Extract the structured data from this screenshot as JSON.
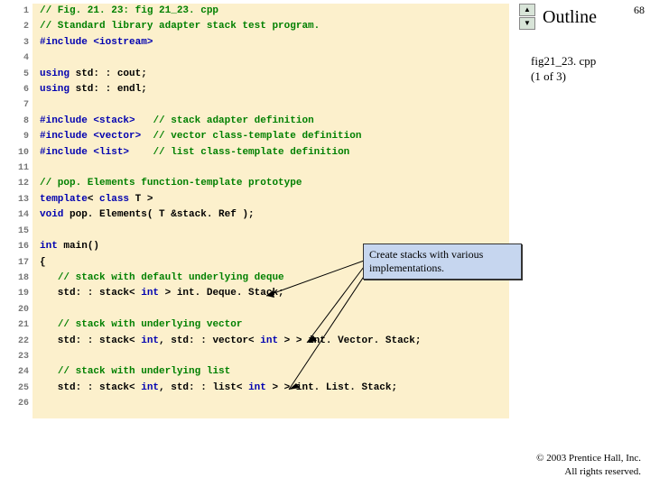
{
  "slide_number": "68",
  "outline": {
    "title": "Outline",
    "file": "fig21_23. cpp",
    "part": "(1 of 3)"
  },
  "callout": "Create stacks with various implementations.",
  "copyright": {
    "line1": "© 2003 Prentice Hall, Inc.",
    "line2": "All rights reserved."
  },
  "code": {
    "line_count": 26,
    "lines": [
      {
        "n": 1,
        "cm": "// Fig. 21. 23: fig 21_23. cpp"
      },
      {
        "n": 2,
        "cm": "// Standard library adapter stack test program."
      },
      {
        "n": 3,
        "pp": "#include <iostream>"
      },
      {
        "n": 4,
        "blank": true
      },
      {
        "n": 5,
        "raw": [
          {
            "t": "using ",
            "c": "kw"
          },
          {
            "t": "std: : cout;"
          }
        ]
      },
      {
        "n": 6,
        "raw": [
          {
            "t": "using ",
            "c": "kw"
          },
          {
            "t": "std: : endl;"
          }
        ]
      },
      {
        "n": 7,
        "blank": true
      },
      {
        "n": 8,
        "raw": [
          {
            "t": "#include <stack>",
            "c": "pp"
          },
          {
            "t": "   "
          },
          {
            "t": "// stack adapter definition",
            "c": "cm"
          }
        ]
      },
      {
        "n": 9,
        "raw": [
          {
            "t": "#include <vector>",
            "c": "pp"
          },
          {
            "t": "  "
          },
          {
            "t": "// vector class-template definition",
            "c": "cm"
          }
        ]
      },
      {
        "n": 10,
        "raw": [
          {
            "t": "#include <list>",
            "c": "pp"
          },
          {
            "t": "    "
          },
          {
            "t": "// list class-template definition",
            "c": "cm"
          }
        ]
      },
      {
        "n": 11,
        "blank": true
      },
      {
        "n": 12,
        "cm": "// pop. Elements function-template prototype"
      },
      {
        "n": 13,
        "raw": [
          {
            "t": "template",
            "c": "kw"
          },
          {
            "t": "< "
          },
          {
            "t": "class",
            "c": "kw"
          },
          {
            "t": " T >"
          }
        ]
      },
      {
        "n": 14,
        "raw": [
          {
            "t": "void",
            "c": "kw"
          },
          {
            "t": " pop. Elements( T &stack. Ref );"
          }
        ]
      },
      {
        "n": 15,
        "blank": true
      },
      {
        "n": 16,
        "raw": [
          {
            "t": "int",
            "c": "kw"
          },
          {
            "t": " main()"
          }
        ]
      },
      {
        "n": 17,
        "raw": [
          {
            "t": "{"
          }
        ]
      },
      {
        "n": 18,
        "raw": [
          {
            "t": "   "
          },
          {
            "t": "// stack with default underlying deque",
            "c": "cm"
          }
        ]
      },
      {
        "n": 19,
        "raw": [
          {
            "t": "   std: : stack< "
          },
          {
            "t": "int",
            "c": "kw"
          },
          {
            "t": " > int. Deque. Stack;"
          }
        ]
      },
      {
        "n": 20,
        "blank": true
      },
      {
        "n": 21,
        "raw": [
          {
            "t": "   "
          },
          {
            "t": "// stack with underlying vector",
            "c": "cm"
          }
        ]
      },
      {
        "n": 22,
        "raw": [
          {
            "t": "   std: : stack< "
          },
          {
            "t": "int",
            "c": "kw"
          },
          {
            "t": ", std: : vector< "
          },
          {
            "t": "int",
            "c": "kw"
          },
          {
            "t": " > > int. Vector. Stack;"
          }
        ]
      },
      {
        "n": 23,
        "blank": true
      },
      {
        "n": 24,
        "raw": [
          {
            "t": "   "
          },
          {
            "t": "// stack with underlying list",
            "c": "cm"
          }
        ]
      },
      {
        "n": 25,
        "raw": [
          {
            "t": "   std: : stack< "
          },
          {
            "t": "int",
            "c": "kw"
          },
          {
            "t": ", std: : list< "
          },
          {
            "t": "int",
            "c": "kw"
          },
          {
            "t": " > > int. List. Stack;"
          }
        ]
      },
      {
        "n": 26,
        "blank": true
      }
    ]
  }
}
